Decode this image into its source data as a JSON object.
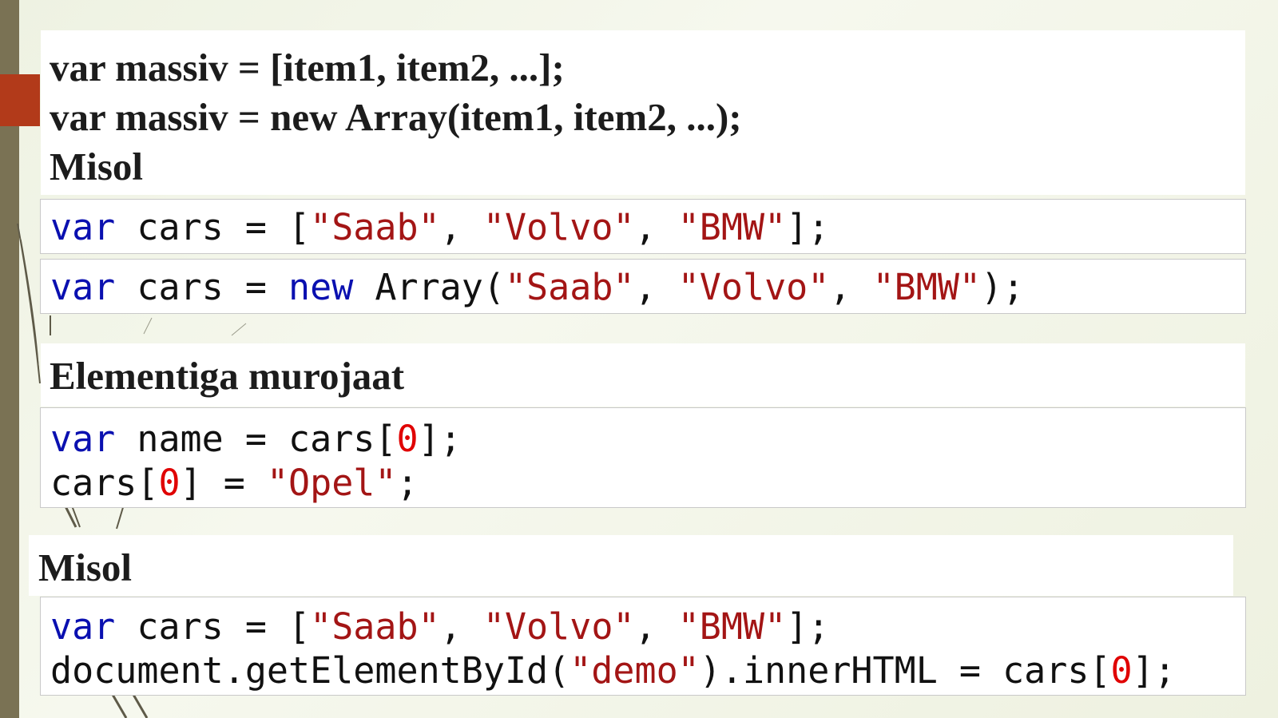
{
  "syntax": {
    "line1": "var massiv = [item1, item2, ...];",
    "line2": "var massiv = new Array(item1, item2, ...);",
    "example_label": "Misol"
  },
  "example1": {
    "line1": {
      "kw": "var",
      "a": " cars = [",
      "s1": "\"Saab\"",
      "c1": ", ",
      "s2": "\"Volvo\"",
      "c2": ", ",
      "s3": "\"BMW\"",
      "end": "];"
    },
    "line2": {
      "kw1": "var",
      "a": " cars = ",
      "kw2": "new",
      "b": " Array(",
      "s1": "\"Saab\"",
      "c1": ", ",
      "s2": "\"Volvo\"",
      "c2": ", ",
      "s3": "\"BMW\"",
      "end": ");"
    }
  },
  "access": {
    "title": "Elementiga murojaat",
    "line1": {
      "kw": "var",
      "a": " name = cars[",
      "n": "0",
      "end": "];"
    },
    "line2": {
      "a": "cars[",
      "n": "0",
      "b": "] = ",
      "s": "\"Opel\"",
      "end": ";"
    }
  },
  "example2": {
    "title": "Misol",
    "line1": {
      "kw": "var",
      "a": " cars = [",
      "s1": "\"Saab\"",
      "c1": ", ",
      "s2": "\"Volvo\"",
      "c2": ", ",
      "s3": "\"BMW\"",
      "end": "];"
    },
    "line2": {
      "a": "document.getElementById(",
      "s": "\"demo\"",
      "b": ").innerHTML = cars[",
      "n": "0",
      "end": "];"
    }
  },
  "colors": {
    "keyword": "#0a10b0",
    "string": "#a31515",
    "number": "#e00000",
    "accent": "#b23a1a",
    "sidebar": "#7a7254"
  }
}
